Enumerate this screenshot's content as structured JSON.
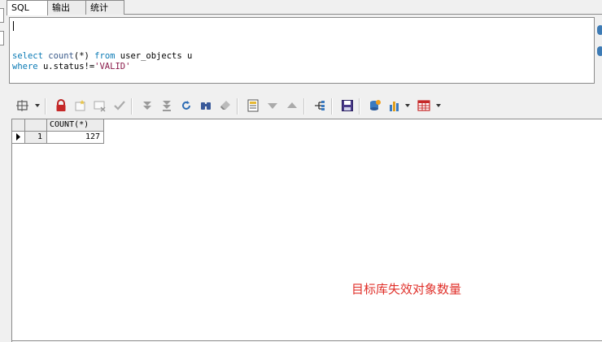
{
  "tabs": [
    {
      "label": "SQL",
      "active": true
    },
    {
      "label": "输出",
      "active": false
    },
    {
      "label": "统计",
      "active": false
    }
  ],
  "editor": {
    "line1": {
      "kw1": "select",
      "fn": "count",
      "args": "(*)",
      "kw2": "from",
      "rest": "user_objects u"
    },
    "line2": {
      "kw1": "where",
      "expr": "u.status!=",
      "str": "'VALID'"
    }
  },
  "toolbar": {
    "icons": [
      "query-builder-icon",
      "lock-icon",
      "new-record-icon",
      "delete-record-icon",
      "post-icon",
      "fetch-next-icon",
      "fetch-last-icon",
      "refresh-icon",
      "find-icon",
      "clear-icon",
      "single-record-icon",
      "next-record-icon",
      "previous-record-icon",
      "explain-plan-icon",
      "save-icon",
      "export-icon",
      "chart-icon",
      "grid-view-icon"
    ]
  },
  "result_grid": {
    "columns": [
      "COUNT(*)"
    ],
    "rows": [
      {
        "num": "1",
        "values": [
          "127"
        ]
      }
    ]
  },
  "annotation": "目标库失效对象数量",
  "colors": {
    "keyword": "#0a7ab5",
    "string": "#8a1a4a",
    "annotation": "#e0302a",
    "border": "#8a8a8a"
  }
}
